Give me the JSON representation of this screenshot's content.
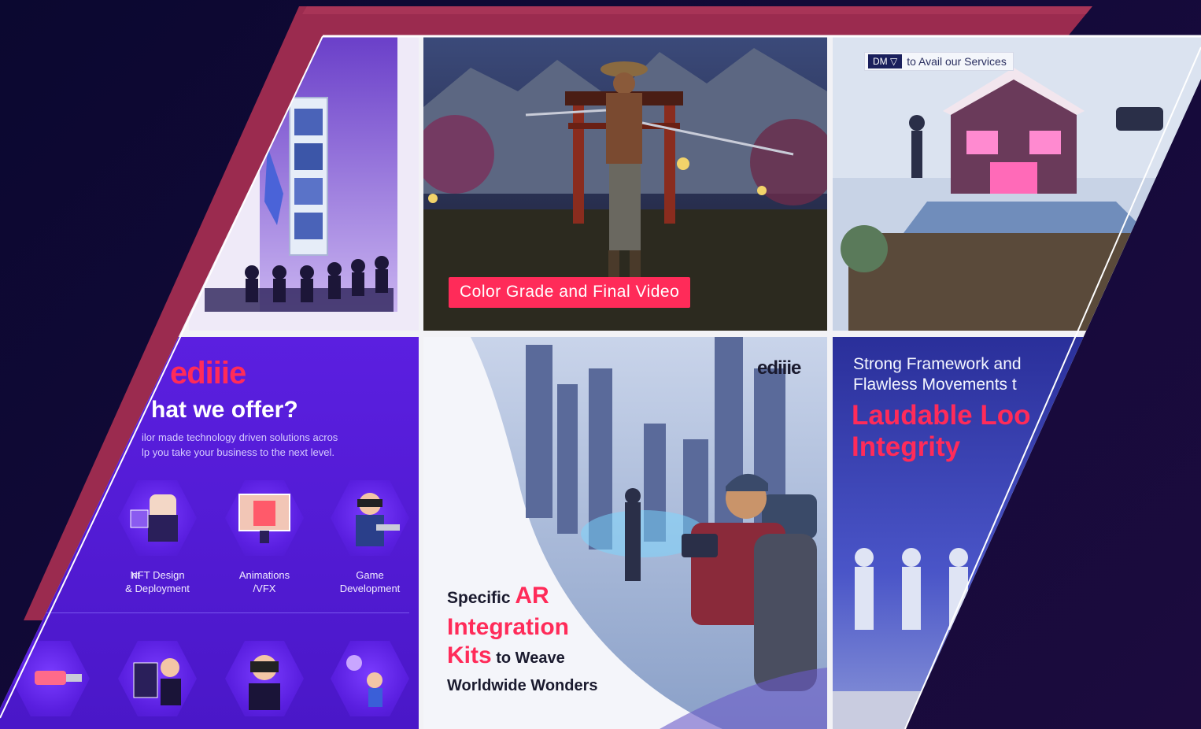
{
  "tiles": {
    "samurai": {
      "caption": "Color Grade and Final Video"
    },
    "house": {
      "cta_tag": "DM ▽",
      "cta_text": "to Avail our Services"
    },
    "services": {
      "logo": "ediiie",
      "heading": "hat we offer?",
      "subtitle_line1": "ilor made technology driven solutions acros",
      "subtitle_line2": "lp you take your business to the next level.",
      "items": [
        {
          "label_line1": "",
          "label_line2": "nt"
        },
        {
          "label_line1": "NFT Design",
          "label_line2": "& Deployment"
        },
        {
          "label_line1": "Animations",
          "label_line2": "/VFX"
        },
        {
          "label_line1": "Game",
          "label_line2": "Development"
        }
      ]
    },
    "ar": {
      "logo": "ediiie",
      "line1_plain": "Specific ",
      "line1_accent": "AR",
      "line2_accent": "Integration",
      "line3_accent": "Kits",
      "line3_plain": " to Weave",
      "line4_plain": "Worldwide Wonders"
    },
    "framework": {
      "line1": "Strong Framework and",
      "line2": "Flawless Movements t",
      "accent1": "Laudable Loo",
      "accent2": "Integrity"
    }
  },
  "colors": {
    "accent_pink": "#ff2b59",
    "banner_crimson": "#9b2b4f",
    "services_purple": "#4a17c8",
    "background_navy": "#0b0830"
  }
}
